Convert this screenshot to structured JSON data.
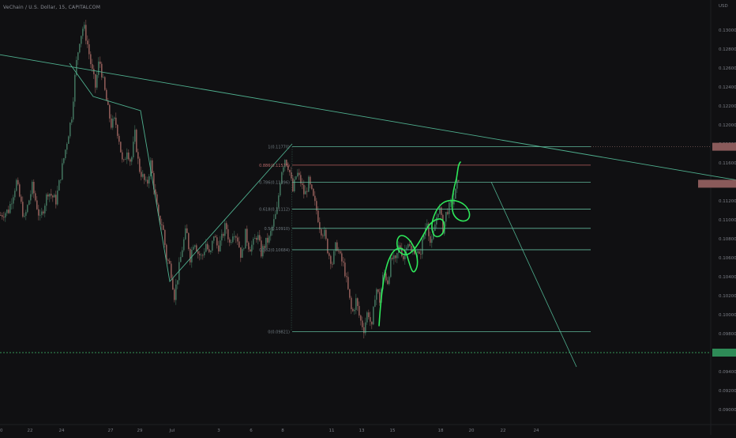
{
  "header": {
    "symbol": "VeChain / U.S. Dollar, 15, CAPITALCOM"
  },
  "colors": {
    "background": "#101012",
    "candle_up": "#3f6f5a",
    "candle_down": "#8c5a56",
    "fib_green": "#5fb79a",
    "fib_red": "#b75f5f",
    "trendline": "#4fb08f",
    "drawing": "#2ee85a",
    "axis_text": "#7a7d85",
    "highlight_red": "#8a5a5a",
    "highlight_green": "#2e8b57"
  },
  "chart_data": {
    "type": "line",
    "title": "",
    "xlabel": "",
    "ylabel": "USD",
    "x_ticks": [
      "20",
      "22",
      "24",
      "27",
      "29",
      "Jul",
      "3",
      "6",
      "8",
      "11",
      "13",
      "15",
      "18",
      "20",
      "22",
      "24"
    ],
    "y_ticks": [
      "0.13000",
      "0.12800",
      "0.12600",
      "0.12400",
      "0.12200",
      "0.12000",
      "0.11800",
      "0.11600",
      "0.11400",
      "0.11200",
      "0.11000",
      "0.10800",
      "0.10600",
      "0.10400",
      "0.10200",
      "0.10000",
      "0.09800",
      "0.09600",
      "0.09400",
      "0.09200",
      "0.09000"
    ],
    "ylim": [
      0.089,
      0.1325
    ],
    "price_path": {
      "name": "VET/USD",
      "x": [
        0,
        10,
        20,
        30,
        40,
        50,
        60,
        70,
        80,
        90,
        95,
        100,
        105,
        110,
        115,
        120,
        125,
        130,
        135,
        140,
        145,
        150,
        155,
        160,
        165,
        170,
        175,
        180,
        185,
        190,
        195,
        200,
        205,
        210,
        215,
        220,
        225,
        230,
        235,
        240,
        245,
        250,
        255,
        260,
        265,
        270,
        275,
        280,
        285,
        290,
        295,
        300,
        305,
        310,
        315,
        320,
        325,
        330,
        335,
        340,
        345,
        350,
        355,
        360,
        365,
        370,
        375,
        380,
        385,
        390,
        395,
        400,
        405,
        410,
        415,
        420,
        425,
        430,
        435,
        440,
        445,
        450,
        455,
        460,
        465,
        470,
        475,
        480,
        485,
        490,
        495,
        500,
        505,
        510,
        515,
        520,
        525,
        530,
        535,
        540,
        545,
        550,
        555,
        560,
        565,
        570,
        575,
        580
      ],
      "y": [
        0.1105,
        0.111,
        0.114,
        0.11,
        0.1135,
        0.11,
        0.113,
        0.112,
        0.1165,
        0.121,
        0.126,
        0.129,
        0.1305,
        0.1285,
        0.126,
        0.124,
        0.127,
        0.1245,
        0.122,
        0.12,
        0.1205,
        0.1185,
        0.1155,
        0.1175,
        0.116,
        0.119,
        0.1155,
        0.1145,
        0.1135,
        0.116,
        0.113,
        0.11,
        0.1095,
        0.106,
        0.105,
        0.102,
        0.1045,
        0.107,
        0.109,
        0.106,
        0.108,
        0.1065,
        0.106,
        0.1075,
        0.106,
        0.1085,
        0.107,
        0.108,
        0.1095,
        0.1075,
        0.109,
        0.108,
        0.106,
        0.1085,
        0.107,
        0.1075,
        0.1085,
        0.1065,
        0.1075,
        0.108,
        0.1095,
        0.111,
        0.115,
        0.1165,
        0.1155,
        0.113,
        0.115,
        0.114,
        0.1125,
        0.114,
        0.1125,
        0.111,
        0.109,
        0.1085,
        0.1065,
        0.1055,
        0.1075,
        0.106,
        0.105,
        0.1025,
        0.1,
        0.1015,
        0.0995,
        0.0985,
        0.1005,
        0.0985,
        0.103,
        0.1015,
        0.1045,
        0.1035,
        0.106,
        0.1055,
        0.1075,
        0.106,
        0.108,
        0.1065,
        0.107,
        0.106,
        0.108,
        0.11,
        0.107,
        0.1095,
        0.1115,
        0.109,
        0.111,
        0.1115,
        0.1125,
        0.1145
      ]
    },
    "fib_levels": [
      {
        "label": "1(0.11770)",
        "value": 0.1177,
        "color": "green"
      },
      {
        "label": "0.886(0.11576)",
        "value": 0.11576,
        "color": "red"
      },
      {
        "label": "0.786(0.11396)",
        "value": 0.11396,
        "color": "green"
      },
      {
        "label": "0.618(0.11112)",
        "value": 0.11112,
        "color": "green"
      },
      {
        "label": "0.5(0.10910)",
        "value": 0.1091,
        "color": "green"
      },
      {
        "label": "0.382(0.10684)",
        "value": 0.10684,
        "color": "green"
      },
      {
        "label": "0(0.09821)",
        "value": 0.09821,
        "color": "green"
      }
    ],
    "fib_x_range": [
      370,
      748
    ],
    "zigzag": {
      "x": [
        88,
        118,
        178,
        215,
        370
      ],
      "y": [
        0.1265,
        0.123,
        0.1215,
        0.1035,
        0.118
      ]
    },
    "trendline": {
      "x": [
        0,
        932
      ],
      "y": [
        0.1274,
        0.1142
      ]
    },
    "projection_line": {
      "x": [
        622,
        730
      ],
      "y": [
        0.114,
        0.0945
      ]
    },
    "horizontal_dashed": 0.096,
    "dotted_level": 0.1177,
    "price_tags": [
      {
        "value": 0.1177,
        "color": "red"
      },
      {
        "value": 0.1138,
        "color": "red"
      },
      {
        "value": 0.096,
        "color": "green"
      }
    ],
    "legend": "none",
    "grid": false
  }
}
